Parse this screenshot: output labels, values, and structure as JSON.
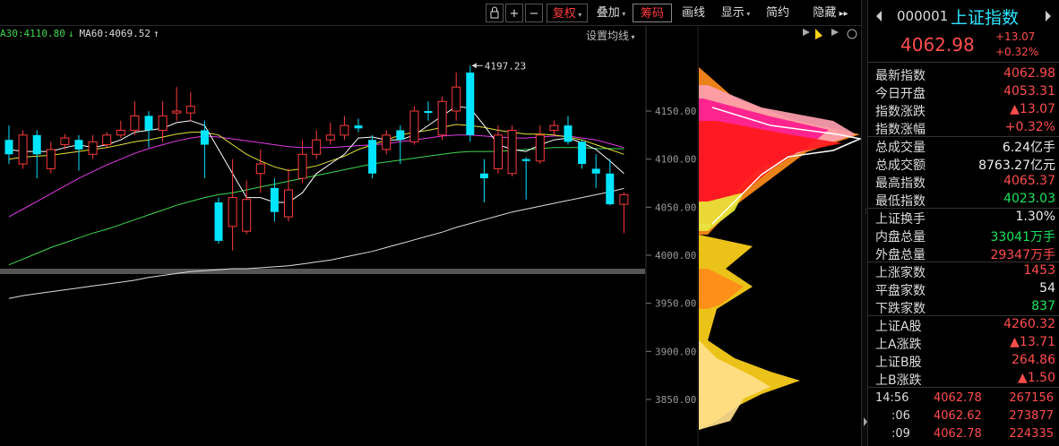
{
  "toolbar": {
    "buttons": [
      {
        "label": "复权",
        "arrow": true
      },
      {
        "label": "叠加",
        "arrow": true
      },
      {
        "label": "筹码"
      },
      {
        "label": "画线"
      },
      {
        "label": "显示",
        "arrow": true
      },
      {
        "label": "简约"
      },
      {
        "label": "隐藏"
      }
    ],
    "plus": "+",
    "minus": "−"
  },
  "ma_labels": [
    {
      "text": "A30:4110.80",
      "arrow": "↓",
      "color": "#3fd84f"
    },
    {
      "text": "MA60:4069.52",
      "arrow": "↑",
      "color": "#dddddd"
    }
  ],
  "set_ma_label": "设置均线",
  "price_axis": [
    "4150.00",
    "4100.00",
    "4050.00",
    "4000.00",
    "3950.00",
    "3900.00",
    "3850.00"
  ],
  "peak_label": "4197.23",
  "stock": {
    "code": "000001",
    "name": "上证指数",
    "price": "4062.98",
    "change": "+13.07",
    "change_pct": "+0.32%"
  },
  "stats": [
    {
      "label": "最新指数",
      "value": "4062.98",
      "color": "red"
    },
    {
      "label": "今日开盘",
      "value": "4053.31",
      "color": "red"
    },
    {
      "label": "指数涨跌",
      "value": "▲13.07",
      "color": "red"
    },
    {
      "label": "指数涨幅",
      "value": "+0.32%",
      "color": "red"
    },
    {
      "label": "总成交量",
      "value": "6.24亿手",
      "color": "white"
    },
    {
      "label": "总成交额",
      "value": "8763.27亿元",
      "color": "white"
    },
    {
      "label": "最高指数",
      "value": "4065.37",
      "color": "red"
    },
    {
      "label": "最低指数",
      "value": "4023.03",
      "color": "green"
    },
    {
      "label": "上证换手",
      "value": "1.30%",
      "color": "white"
    },
    {
      "label": "内盘总量",
      "value": "33041万手",
      "color": "green"
    },
    {
      "label": "外盘总量",
      "value": "29347万手",
      "color": "red"
    },
    {
      "label": "上涨家数",
      "value": "1453",
      "color": "red"
    },
    {
      "label": "平盘家数",
      "value": "54",
      "color": "white"
    },
    {
      "label": "下跌家数",
      "value": "837",
      "color": "green"
    },
    {
      "label": "上证A股",
      "value": "4260.32",
      "color": "red"
    },
    {
      "label": "上A涨跌",
      "value": "▲13.71",
      "color": "red"
    },
    {
      "label": "上证B股",
      "value": "264.86",
      "color": "red"
    },
    {
      "label": "上B涨跌",
      "value": "▲1.50",
      "color": "red"
    }
  ],
  "ticks": [
    {
      "time": "14:56",
      "price": "4062.78",
      "volume": "267156"
    },
    {
      "time": ":06",
      "price": "4062.62",
      "volume": "273877"
    },
    {
      "time": ":09",
      "price": "4062.78",
      "volume": "224335"
    }
  ],
  "colors": {
    "up": "#ff3b3b",
    "down": "#00e5ff",
    "ma5": "#ffffff",
    "ma10": "#e5e23a",
    "ma20": "#e23ae5",
    "ma30": "#3fd84f",
    "ma60": "#dddddd"
  },
  "chart_data": {
    "type": "candlestick",
    "y_range": [
      3830,
      4220
    ],
    "candles": [
      {
        "o": 4120,
        "c": 4105,
        "h": 4135,
        "l": 4095
      },
      {
        "o": 4095,
        "c": 4125,
        "h": 4130,
        "l": 4090
      },
      {
        "o": 4125,
        "c": 4105,
        "h": 4130,
        "l": 4080
      },
      {
        "o": 4090,
        "c": 4110,
        "h": 4118,
        "l": 4085
      },
      {
        "o": 4115,
        "c": 4122,
        "h": 4126,
        "l": 4110
      },
      {
        "o": 4120,
        "c": 4110,
        "h": 4125,
        "l": 4088
      },
      {
        "o": 4105,
        "c": 4118,
        "h": 4125,
        "l": 4100
      },
      {
        "o": 4115,
        "c": 4125,
        "h": 4128,
        "l": 4112
      },
      {
        "o": 4125,
        "c": 4130,
        "h": 4140,
        "l": 4122
      },
      {
        "o": 4130,
        "c": 4145,
        "h": 4160,
        "l": 4125
      },
      {
        "o": 4145,
        "c": 4130,
        "h": 4150,
        "l": 4112
      },
      {
        "o": 4130,
        "c": 4145,
        "h": 4160,
        "l": 4118
      },
      {
        "o": 4148,
        "c": 4150,
        "h": 4175,
        "l": 4140
      },
      {
        "o": 4148,
        "c": 4155,
        "h": 4170,
        "l": 4140
      },
      {
        "o": 4130,
        "c": 4115,
        "h": 4140,
        "l": 4080
      },
      {
        "o": 4055,
        "c": 4015,
        "h": 4060,
        "l": 4012
      },
      {
        "o": 4030,
        "c": 4060,
        "h": 4100,
        "l": 4005
      },
      {
        "o": 4025,
        "c": 4058,
        "h": 4078,
        "l": 4022
      },
      {
        "o": 4085,
        "c": 4095,
        "h": 4110,
        "l": 4065
      },
      {
        "o": 4070,
        "c": 4045,
        "h": 4080,
        "l": 4035
      },
      {
        "o": 4040,
        "c": 4068,
        "h": 4090,
        "l": 4035
      },
      {
        "o": 4080,
        "c": 4105,
        "h": 4120,
        "l": 4075
      },
      {
        "o": 4105,
        "c": 4120,
        "h": 4130,
        "l": 4100
      },
      {
        "o": 4120,
        "c": 4125,
        "h": 4138,
        "l": 4115
      },
      {
        "o": 4125,
        "c": 4135,
        "h": 4145,
        "l": 4120
      },
      {
        "o": 4135,
        "c": 4132,
        "h": 4142,
        "l": 4128
      },
      {
        "o": 4120,
        "c": 4085,
        "h": 4125,
        "l": 4080
      },
      {
        "o": 4110,
        "c": 4125,
        "h": 4130,
        "l": 4105
      },
      {
        "o": 4130,
        "c": 4120,
        "h": 4135,
        "l": 4095
      },
      {
        "o": 4118,
        "c": 4150,
        "h": 4155,
        "l": 4115
      },
      {
        "o": 4150,
        "c": 4148,
        "h": 4160,
        "l": 4140
      },
      {
        "o": 4125,
        "c": 4160,
        "h": 4165,
        "l": 4120
      },
      {
        "o": 4150,
        "c": 4175,
        "h": 4190,
        "l": 4140
      },
      {
        "o": 4190,
        "c": 4125,
        "h": 4197.23,
        "l": 4118
      },
      {
        "o": 4085,
        "c": 4080,
        "h": 4100,
        "l": 4055
      },
      {
        "o": 4090,
        "c": 4125,
        "h": 4135,
        "l": 4085
      },
      {
        "o": 4085,
        "c": 4130,
        "h": 4135,
        "l": 4082
      },
      {
        "o": 4100,
        "c": 4098,
        "h": 4102,
        "l": 4058
      },
      {
        "o": 4098,
        "c": 4125,
        "h": 4135,
        "l": 4095
      },
      {
        "o": 4130,
        "c": 4135,
        "h": 4140,
        "l": 4125
      },
      {
        "o": 4135,
        "c": 4118,
        "h": 4145,
        "l": 4115
      },
      {
        "o": 4118,
        "c": 4095,
        "h": 4120,
        "l": 4090
      },
      {
        "o": 4090,
        "c": 4085,
        "h": 4105,
        "l": 4070
      },
      {
        "o": 4085,
        "c": 4053,
        "h": 4100,
        "l": 4052
      },
      {
        "o": 4053,
        "c": 4063,
        "h": 4065.37,
        "l": 4023.03
      }
    ],
    "ma5": [
      4110,
      4108,
      4108,
      4108,
      4112,
      4115,
      4112,
      4115,
      4120,
      4128,
      4130,
      4132,
      4138,
      4140,
      4135,
      4110,
      4085,
      4060,
      4060,
      4055,
      4055,
      4065,
      4085,
      4095,
      4105,
      4122,
      4123,
      4120,
      4120,
      4125,
      4135,
      4145,
      4155,
      4153,
      4135,
      4115,
      4110,
      4108,
      4115,
      4120,
      4122,
      4117,
      4110,
      4098,
      4085
    ],
    "ma10": [
      4100,
      4102,
      4103,
      4104,
      4106,
      4108,
      4110,
      4112,
      4115,
      4118,
      4120,
      4123,
      4126,
      4128,
      4128,
      4125,
      4115,
      4105,
      4098,
      4092,
      4088,
      4090,
      4093,
      4098,
      4103,
      4110,
      4115,
      4120,
      4125,
      4128,
      4130,
      4133,
      4136,
      4135,
      4133,
      4130,
      4128,
      4126,
      4126,
      4125,
      4123,
      4120,
      4115,
      4110,
      4105
    ],
    "ma20": [
      4040,
      4048,
      4056,
      4064,
      4072,
      4080,
      4087,
      4094,
      4100,
      4106,
      4111,
      4115,
      4119,
      4122,
      4124,
      4123,
      4121,
      4119,
      4117,
      4115,
      4113,
      4112,
      4112,
      4112,
      4113,
      4114,
      4115,
      4116,
      4118,
      4120,
      4122,
      4124,
      4125,
      4125,
      4124,
      4123,
      4122,
      4122,
      4123,
      4124,
      4124,
      4122,
      4120,
      4116,
      4112
    ],
    "ma30": [
      3990,
      3996,
      4002,
      4008,
      4013,
      4018,
      4023,
      4027,
      4032,
      4037,
      4042,
      4047,
      4052,
      4056,
      4060,
      4063,
      4065,
      4068,
      4071,
      4074,
      4077,
      4080,
      4083,
      4086,
      4089,
      4092,
      4095,
      4097,
      4099,
      4101,
      4103,
      4105,
      4107,
      4108,
      4108,
      4108,
      4109,
      4110,
      4111,
      4112,
      4112,
      4112,
      4111,
      4111,
      4110.8
    ],
    "ma60": [
      3955,
      3958,
      3960,
      3962,
      3964,
      3966,
      3968,
      3970,
      3972,
      3974,
      3977,
      3979,
      3981,
      3983,
      3984,
      3985,
      3986,
      3986,
      3987,
      3988,
      3989,
      3991,
      3993,
      3995,
      3998,
      4001,
      4004,
      4008,
      4012,
      4016,
      4020,
      4024,
      4029,
      4033,
      4037,
      4041,
      4045,
      4048,
      4051,
      4054,
      4057,
      4060,
      4063,
      4066,
      4069.52
    ]
  }
}
